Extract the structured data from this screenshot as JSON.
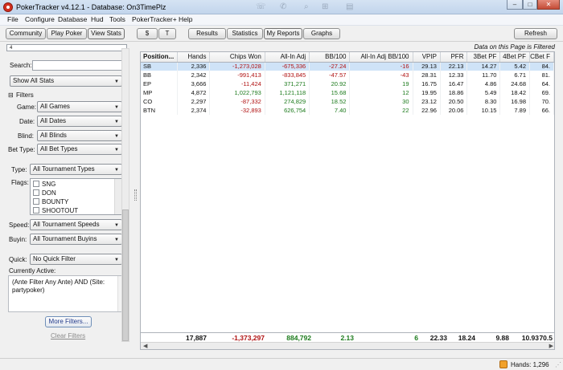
{
  "window": {
    "title": "PokerTracker v4.12.1 - Database: On3TimePlz",
    "controls": {
      "minimize": "–",
      "maximize": "□",
      "close": "✕"
    }
  },
  "menu": [
    "File",
    "Configure",
    "Database",
    "Hud",
    "Tools",
    "PokerTracker+",
    "Help"
  ],
  "toolbar": {
    "left_tabs": [
      "Community",
      "Play Poker",
      "View Stats"
    ],
    "currency": [
      "$",
      "T"
    ],
    "report_tabs": [
      "Results",
      "Statistics",
      "My Reports",
      "Graphs"
    ],
    "selected_report_tab": "My Reports",
    "refresh": "Refresh"
  },
  "sidebar": {
    "top_input_value": "4",
    "search_label": "Search:",
    "search_value": "",
    "stats_select": "Show All Stats",
    "filters_header": "Filters",
    "game_label": "Game:",
    "game_value": "All Games",
    "date_label": "Date:",
    "date_value": "All Dates",
    "blind_label": "Blind:",
    "blind_value": "All Blinds",
    "bettype_label": "Bet Type:",
    "bettype_value": "All Bet Types",
    "type_label": "Type:",
    "type_value": "All Tournament Types",
    "flags_label": "Flags:",
    "flags": [
      "SNG",
      "DON",
      "BOUNTY",
      "SHOOTOUT"
    ],
    "speed_label": "Speed:",
    "speed_value": "All Tournament Speeds",
    "buyin_label": "Buyin:",
    "buyin_value": "All Tournament Buyins",
    "quick_label": "Quick:",
    "quick_value": "No Quick Filter",
    "currently_active_label": "Currently Active:",
    "currently_active_text": "(Ante Filter Any Ante) AND (Site: partypoker)",
    "more_filters": "More Filters...",
    "clear_filters": "Clear Filters"
  },
  "report": {
    "filter_note": "Data on this Page is Filtered",
    "columns": [
      "Position...",
      "Hands",
      "Chips Won",
      "All-In Adj",
      "BB/100",
      "All-In Adj BB/100",
      "VPIP",
      "PFR",
      "3Bet PF",
      "4Bet PF",
      "CBet F"
    ],
    "rows": [
      {
        "cells": [
          "SB",
          "2,336",
          "-1,273,028",
          "-675,336",
          "-27.24",
          "-16",
          "29.13",
          "22.13",
          "14.27",
          "5.42",
          "84."
        ],
        "selected": true
      },
      {
        "cells": [
          "BB",
          "2,342",
          "-991,413",
          "-833,845",
          "-47.57",
          "-43",
          "28.31",
          "12.33",
          "11.70",
          "6.71",
          "81."
        ]
      },
      {
        "cells": [
          "EP",
          "3,666",
          "-11,424",
          "371,271",
          "20.92",
          "19",
          "16.75",
          "16.47",
          "4.86",
          "24.68",
          "64."
        ]
      },
      {
        "cells": [
          "MP",
          "4,872",
          "1,022,793",
          "1,121,118",
          "15.68",
          "12",
          "19.95",
          "18.86",
          "5.49",
          "18.42",
          "69."
        ]
      },
      {
        "cells": [
          "CO",
          "2,297",
          "-87,332",
          "274,829",
          "18.52",
          "30",
          "23.12",
          "20.50",
          "8.30",
          "16.98",
          "70."
        ]
      },
      {
        "cells": [
          "BTN",
          "2,374",
          "-32,893",
          "626,754",
          "7.40",
          "22",
          "22.96",
          "20.06",
          "10.15",
          "7.89",
          "66."
        ]
      }
    ],
    "totals": [
      "17,887",
      "-1,373,297",
      "884,792",
      "2.13",
      "6",
      "22.33",
      "18.24",
      "9.88",
      "10.93",
      "70.5"
    ]
  },
  "status": {
    "hands": "Hands: 1,296"
  },
  "colors": {
    "positive": "#1b7a1b",
    "negative": "#b01010",
    "selected_row": "#cfe3f7"
  }
}
